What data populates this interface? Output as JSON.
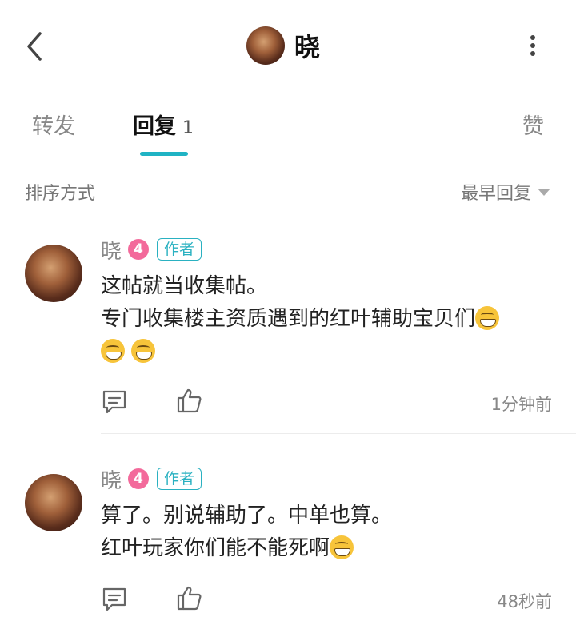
{
  "header": {
    "title": "晓"
  },
  "tabs": {
    "forward": "转发",
    "reply": "回复",
    "reply_count": "1",
    "like": "赞"
  },
  "sort": {
    "label": "排序方式",
    "selected": "最早回复"
  },
  "comments": [
    {
      "name": "晓",
      "level": "4",
      "badge": "作者",
      "line1": "这帖就当收集帖。",
      "line2": "专门收集楼主资质遇到的红叶辅助宝贝们",
      "time": "1分钟前"
    },
    {
      "name": "晓",
      "level": "4",
      "badge": "作者",
      "line1": "算了。别说辅助了。中单也算。",
      "line2": "红叶玩家你们能不能死啊",
      "time": "48秒前"
    }
  ]
}
